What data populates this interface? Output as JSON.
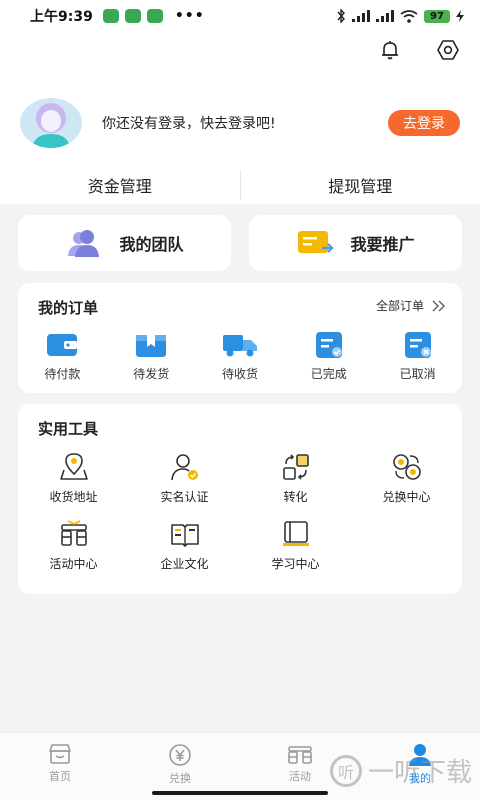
{
  "status_bar": {
    "time": "上午9:39",
    "dots": "•••",
    "battery": "97"
  },
  "profile": {
    "tip": "你还没有登录，快去登录吧!",
    "login_label": "去登录"
  },
  "fund_tabs": [
    "资金管理",
    "提现管理"
  ],
  "big_cards": {
    "team": "我的团队",
    "promote": "我要推广"
  },
  "orders": {
    "title": "我的订单",
    "all_label": "全部订单",
    "items": [
      "待付款",
      "待发货",
      "待收货",
      "已完成",
      "已取消"
    ]
  },
  "tools": {
    "title": "实用工具",
    "items": [
      "收货地址",
      "实名认证",
      "转化",
      "兑换中心",
      "活动中心",
      "企业文化",
      "学习中心"
    ]
  },
  "tabbar": {
    "items": [
      "首页",
      "兑换",
      "活动",
      "我的"
    ],
    "active_index": 3
  },
  "watermark": {
    "logo_glyph": "听",
    "text": "一听下载"
  },
  "colors": {
    "accent_blue": "#1e88e5",
    "orange": "#f56a2c",
    "icon_blue": "#2d8fdf",
    "icon_yellow": "#f5b800",
    "team_purple": "#7b7fe0"
  }
}
